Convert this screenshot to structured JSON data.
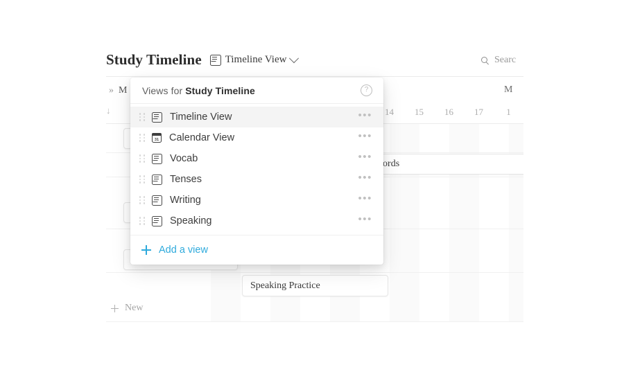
{
  "header": {
    "page_title": "Study Timeline",
    "view_chip_label": "Timeline View",
    "view_chip_icon": "document-view-icon",
    "chevron_icon": "chevron-down-icon",
    "search_label": "Searc",
    "search_icon": "search-icon"
  },
  "table": {
    "collapse_icon": "double-chevron-right-icon",
    "name_column": "M",
    "sort_arrow": "↓",
    "month_label": "M",
    "days": [
      "14",
      "15",
      "16",
      "17",
      "1"
    ],
    "new_row_label": "New",
    "new_row_icon": "plus-icon"
  },
  "events": [
    {
      "label": "ocab words"
    },
    {
      "label": "Speaking Practice"
    }
  ],
  "popup": {
    "title_prefix": "Views for ",
    "title_target": "Study Timeline",
    "help_icon": "question-mark-circle-icon",
    "help_glyph": "?",
    "ellipsis_glyph": "•••",
    "views": [
      {
        "label": "Timeline View",
        "icon": "document-view-icon",
        "selected": true
      },
      {
        "label": "Calendar View",
        "icon": "calendar-icon",
        "calendar_day": "31",
        "selected": false
      },
      {
        "label": "Vocab",
        "icon": "document-view-icon",
        "selected": false
      },
      {
        "label": "Tenses",
        "icon": "document-view-icon",
        "selected": false
      },
      {
        "label": "Writing",
        "icon": "document-view-icon",
        "selected": false
      },
      {
        "label": "Speaking",
        "icon": "document-view-icon",
        "selected": false
      }
    ],
    "add_view_label": "Add a view",
    "add_view_icon": "plus-icon",
    "accent_color": "#2eaadc"
  }
}
